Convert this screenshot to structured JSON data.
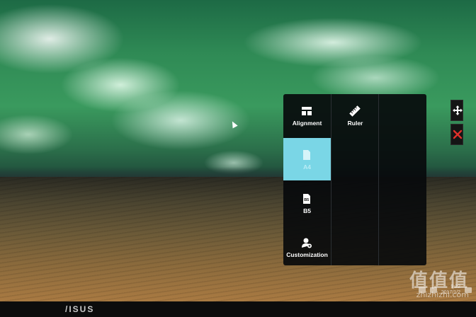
{
  "menu": {
    "col1": [
      {
        "label": "Alignment",
        "icon": "alignment-grid-icon"
      },
      {
        "label": "A4",
        "icon": "a4-paper-icon",
        "active": true
      },
      {
        "label": "B5",
        "icon": "b5-paper-icon"
      },
      {
        "label": "Customization",
        "icon": "customization-user-icon"
      }
    ],
    "col2": [
      {
        "label": "Ruler",
        "icon": "ruler-icon"
      }
    ],
    "b5_icon_text": "B5",
    "a4_icon_text": "A4"
  },
  "side_buttons": [
    {
      "icon": "move-arrows-icon"
    },
    {
      "icon": "close-icon",
      "color": "#e0302a"
    }
  ],
  "bezel": {
    "logo": "/ISUS"
  },
  "tray": {
    "time": "9:22",
    "date": "2017/1/2"
  },
  "watermark": {
    "big": "值值值",
    "small": "zhizhizhi.com"
  },
  "colors": {
    "active": "#7ad6e6",
    "panel": "#08090c",
    "close": "#e0302a"
  }
}
